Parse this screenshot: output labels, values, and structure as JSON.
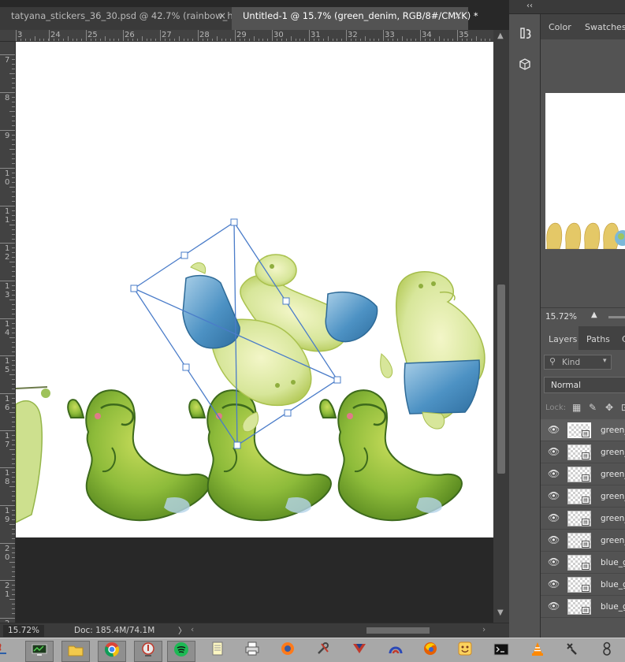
{
  "tabs": [
    {
      "label": "tatyana_stickers_36_30.psd @ 42.7% (rainbow_h...",
      "close": "×"
    },
    {
      "label": "Untitled-1 @ 15.7% (green_denim, RGB/8#/CMYK) *",
      "close": "×"
    }
  ],
  "ruler_top": [
    "3",
    "24",
    "25",
    "26",
    "27",
    "28",
    "29",
    "30",
    "31",
    "32",
    "33",
    "34",
    "35"
  ],
  "ruler_left": [
    {
      "l1": "7",
      "l2": ""
    },
    {
      "l1": "8",
      "l2": ""
    },
    {
      "l1": "9",
      "l2": ""
    },
    {
      "l1": "1",
      "l2": "0"
    },
    {
      "l1": "1",
      "l2": "1"
    },
    {
      "l1": "1",
      "l2": "2"
    },
    {
      "l1": "1",
      "l2": "3"
    },
    {
      "l1": "1",
      "l2": "4"
    },
    {
      "l1": "1",
      "l2": "5"
    },
    {
      "l1": "1",
      "l2": "6"
    },
    {
      "l1": "1",
      "l2": "7"
    },
    {
      "l1": "1",
      "l2": "8"
    },
    {
      "l1": "1",
      "l2": "9"
    },
    {
      "l1": "2",
      "l2": "0"
    },
    {
      "l1": "2",
      "l2": "1"
    },
    {
      "l1": "2",
      "l2": "2"
    }
  ],
  "status": {
    "zoom": "15.72%",
    "doc": "Doc: 185.4M/74.1M",
    "arrow": "〉",
    "scroll_left": "‹",
    "scroll_right": "›"
  },
  "panels": {
    "collapse": "‹‹",
    "color_tab": "Color",
    "swatches_tab": "Swatches",
    "navigator_zoom": "15.72%",
    "layers_tab": "Layers",
    "paths_tab": "Paths",
    "channels_tab_partial": "C",
    "kind_placeholder": "Kind",
    "blend_mode": "Normal",
    "lock_label": "Lock:"
  },
  "layers": [
    {
      "name": "green_",
      "selected": true
    },
    {
      "name": "green_",
      "selected": false
    },
    {
      "name": "green_",
      "selected": false
    },
    {
      "name": "green_",
      "selected": false
    },
    {
      "name": "green_",
      "selected": false
    },
    {
      "name": "green_",
      "selected": false
    },
    {
      "name": "blue_g",
      "selected": false
    },
    {
      "name": "blue_g",
      "selected": false
    },
    {
      "name": "blue_g",
      "selected": false
    }
  ],
  "colors": {
    "frog_green": "#8dbb3a",
    "frog_dark": "#4f7a1c",
    "ghost_green": "#d7e69a",
    "denim_blue": "#4d92c4",
    "denim_light": "#a9cfe8",
    "blush": "#e07a8a",
    "transform_line": "#4a7cc9"
  }
}
